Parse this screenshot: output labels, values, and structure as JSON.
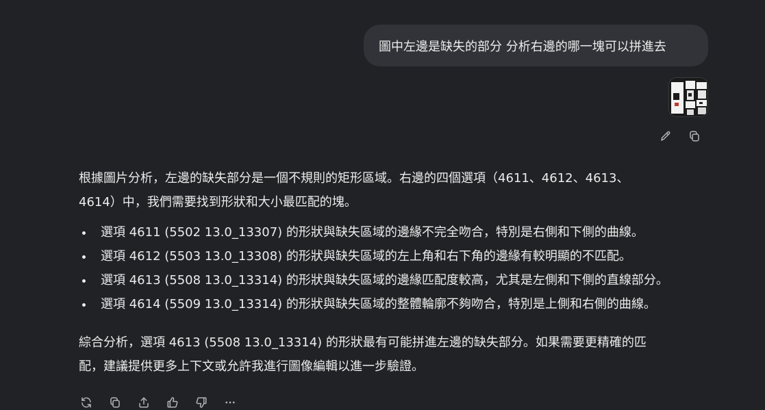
{
  "user_message": {
    "text": "圖中左邊是缺失的部分 分析右邊的哪一塊可以拼進去",
    "attachment_icon": "image-thumbnail",
    "actions": [
      "edit-icon",
      "copy-icon"
    ]
  },
  "assistant": {
    "intro_line1": "根據圖片分析，左邊的缺失部分是一個不規則的矩形區域。右邊的四個選項（4611、4612、4613、",
    "intro_line2": "4614）中，我們需要找到形狀和大小最匹配的塊。",
    "bullets": [
      "選項 4611 (5502 13.0_13307) 的形狀與缺失區域的邊緣不完全吻合，特別是右側和下側的曲線。",
      "選項 4612 (5503 13.0_13308) 的形狀與缺失區域的左上角和右下角的邊緣有較明顯的不匹配。",
      "選項 4613 (5508 13.0_13314) 的形狀與缺失區域的邊緣匹配度較高，尤其是左側和下側的直線部分。",
      "選項 4614 (5509 13.0_13314) 的形狀與缺失區域的整體輪廓不夠吻合，特別是上側和右側的曲線。"
    ],
    "conclusion_line1": "綜合分析，選項 4613 (5508 13.0_13314) 的形狀最有可能拼進左邊的缺失部分。如果需要更精確的匹",
    "conclusion_line2": "配，建議提供更多上下文或允許我進行圖像編輯以進一步驗證。"
  },
  "toolbar": {
    "icons": [
      "regenerate-icon",
      "copy-icon",
      "share-icon",
      "thumbs-up-icon",
      "thumbs-down-icon",
      "more-icon"
    ]
  },
  "colors": {
    "background": "#212226",
    "bubble": "#323338",
    "text": "#ececec",
    "icon": "#b4b4b4"
  }
}
